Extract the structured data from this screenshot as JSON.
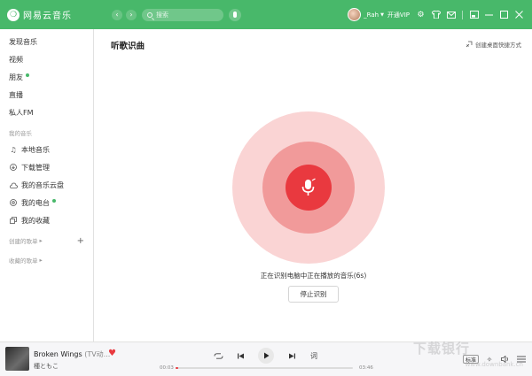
{
  "app": {
    "name": "网易云音乐",
    "logo_glyph": "❍",
    "brand_color": "#48b86a",
    "accent_color": "#e9393f"
  },
  "titlebar": {
    "search_placeholder": "搜索",
    "username": "_Rah",
    "vip_label": "开通VIP",
    "icons": [
      "settings-icon",
      "skin-icon",
      "mail-icon",
      "mini-mode-icon",
      "minimize-icon",
      "maximize-icon",
      "close-icon"
    ]
  },
  "sidebar": {
    "items": [
      {
        "label": "发现音乐"
      },
      {
        "label": "视频"
      },
      {
        "label": "朋友"
      },
      {
        "label": "直播"
      },
      {
        "label": "私人FM"
      }
    ],
    "my_music_group": "我的音乐",
    "my_music": [
      {
        "label": "本地音乐",
        "icon": "music-note-icon"
      },
      {
        "label": "下载管理",
        "icon": "download-icon"
      },
      {
        "label": "我的音乐云盘",
        "icon": "cloud-icon"
      },
      {
        "label": "我的电台",
        "icon": "radio-icon"
      },
      {
        "label": "我的收藏",
        "icon": "collection-icon"
      }
    ],
    "created_playlists": "创建的歌单",
    "collected_playlists": "收藏的歌单"
  },
  "main": {
    "title": "听歌识曲",
    "shortcut_label": "创建桌面快捷方式",
    "status_text": "正在识别电脑中正在播放的音乐(6s)",
    "stop_button": "停止识别"
  },
  "player": {
    "song_title": "Broken Wings",
    "song_subtitle": "(TV动...",
    "artist": "種ともこ",
    "time_current": "00:03",
    "time_total": "03:46",
    "progress_fraction": 0.015,
    "quality": "标准",
    "lyrics_label": "词"
  },
  "watermark": {
    "text": "下载银行",
    "sub": "www.downbank.cn"
  }
}
